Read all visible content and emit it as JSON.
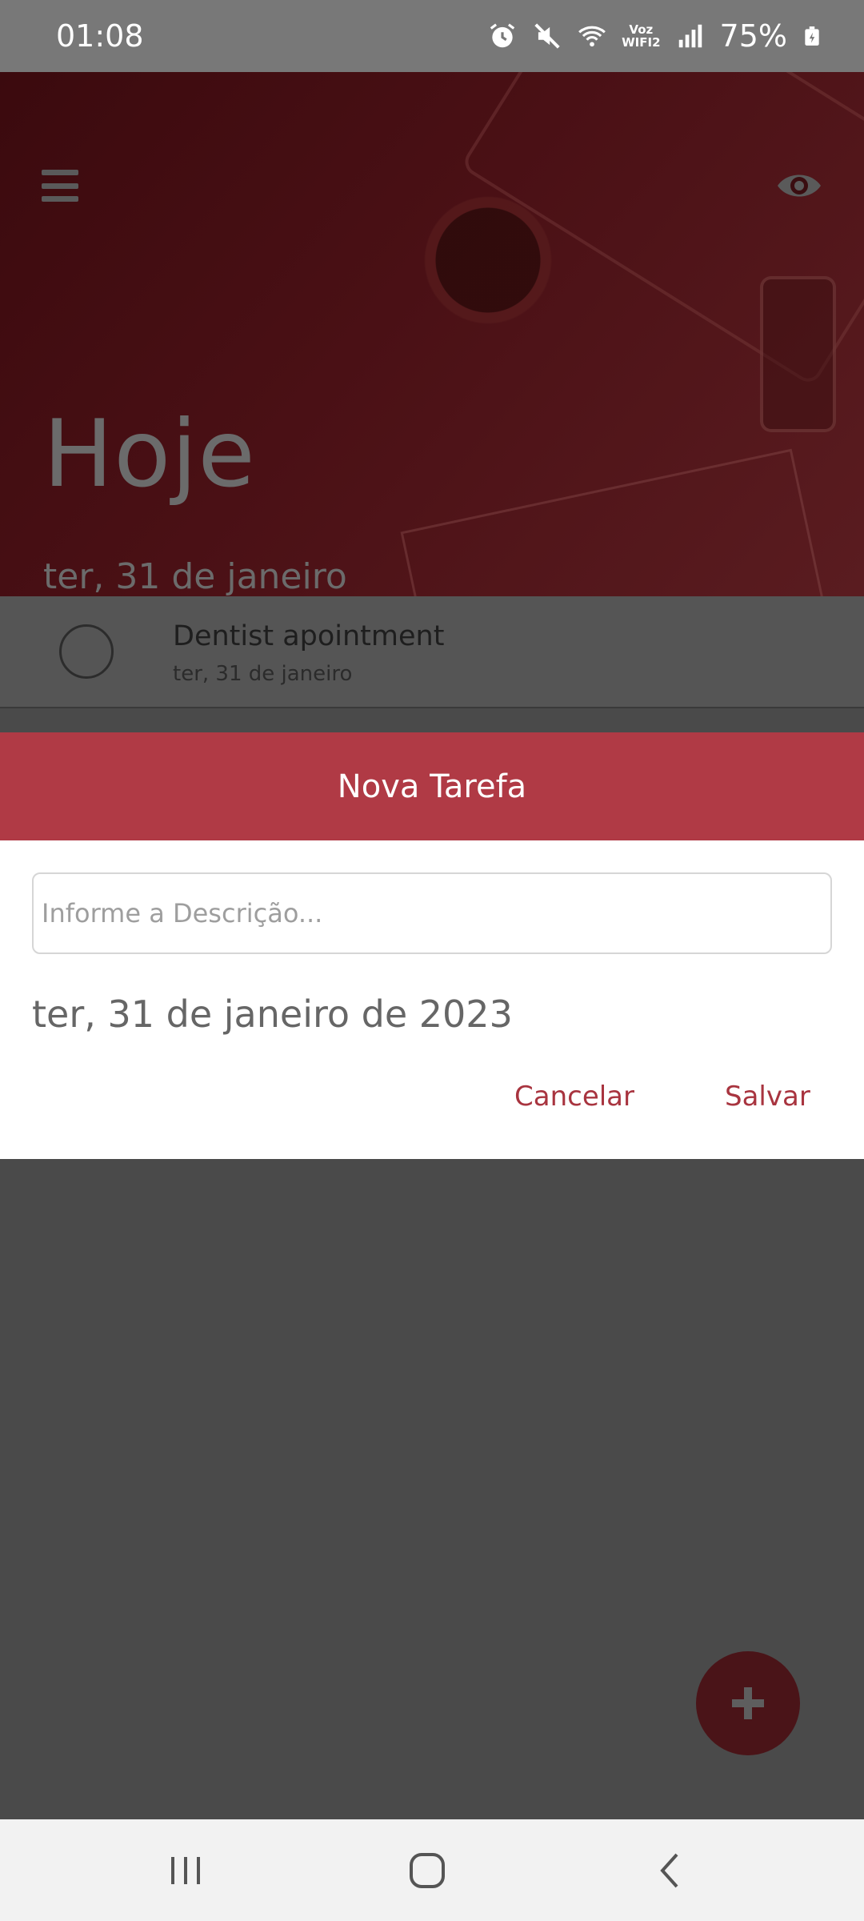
{
  "status_bar": {
    "time": "01:08",
    "voz_line1": "Voz",
    "voz_line2": "WIFI2",
    "battery": "75%",
    "icons": [
      "alarm-icon",
      "mute-icon",
      "wifi-icon",
      "signal-icon",
      "battery-icon"
    ]
  },
  "header": {
    "title": "Hoje",
    "date": "ter, 31 de janeiro",
    "icons": [
      "menu-icon",
      "eye-icon"
    ]
  },
  "tasks": [
    {
      "title": "Dentist apointment",
      "date": "ter, 31 de janeiro",
      "done": false
    }
  ],
  "dialog": {
    "title": "Nova Tarefa",
    "description_value": "",
    "description_placeholder": "Informe a Descrição...",
    "date": "ter, 31 de janeiro de 2023",
    "cancel_label": "Cancelar",
    "save_label": "Salvar"
  },
  "fab": {
    "icon": "plus-icon"
  },
  "nav_bar": {
    "icons": [
      "recent-apps-icon",
      "home-icon",
      "back-icon"
    ]
  },
  "colors": {
    "dialog_header": "#b03a45",
    "accent_text": "#a8343f",
    "hero_bg": "#4a1015",
    "scrim": "#4a4a4a"
  }
}
